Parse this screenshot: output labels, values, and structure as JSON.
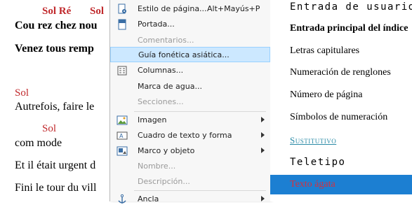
{
  "document": {
    "chords_1": "Sol Ré",
    "chords_1b": "Sol",
    "line_1": "Cou rez chez nou",
    "line_2": "Venez tous remp",
    "chord_2": "Sol",
    "line_3": "Autrefois, faire le",
    "chord_3": "Sol",
    "line_4": "com mode",
    "line_5": "Et il était urgent d",
    "line_6": "Fini le tour du vill"
  },
  "menu": {
    "items": [
      {
        "label": "Estilo de página...",
        "accel": "Alt+Mayús+P",
        "disabled": false
      },
      {
        "label": "Portada...",
        "disabled": false
      },
      {
        "label": "Comentarios...",
        "disabled": true
      },
      {
        "label": "Guía fonética asiática...",
        "disabled": false,
        "highlighted": true
      },
      {
        "label": "Columnas...",
        "disabled": false
      },
      {
        "label": "Marca de agua...",
        "disabled": false
      },
      {
        "label": "Secciones...",
        "disabled": true
      },
      {
        "label": "Imagen",
        "submenu": true
      },
      {
        "label": "Cuadro de texto y forma",
        "submenu": true
      },
      {
        "label": "Marco y objeto",
        "submenu": true
      },
      {
        "label": "Nombre...",
        "disabled": true
      },
      {
        "label": "Descripción...",
        "disabled": true
      },
      {
        "label": "Ancla",
        "submenu": true
      }
    ]
  },
  "styles_panel": {
    "items": [
      "Entrada de usuario",
      "Entrada principal del índice",
      "Letras capitulares",
      "Numeración de renglones",
      "Número de página",
      "Símbolos de numeración",
      "Sustitutivo",
      "Teletipo",
      "Texto ágata"
    ]
  },
  "colors": {
    "chord_red": "#c0282b",
    "highlight": "#cce8ff",
    "selected_row": "#1c7fd2",
    "link_teal": "#2a8aa6"
  }
}
